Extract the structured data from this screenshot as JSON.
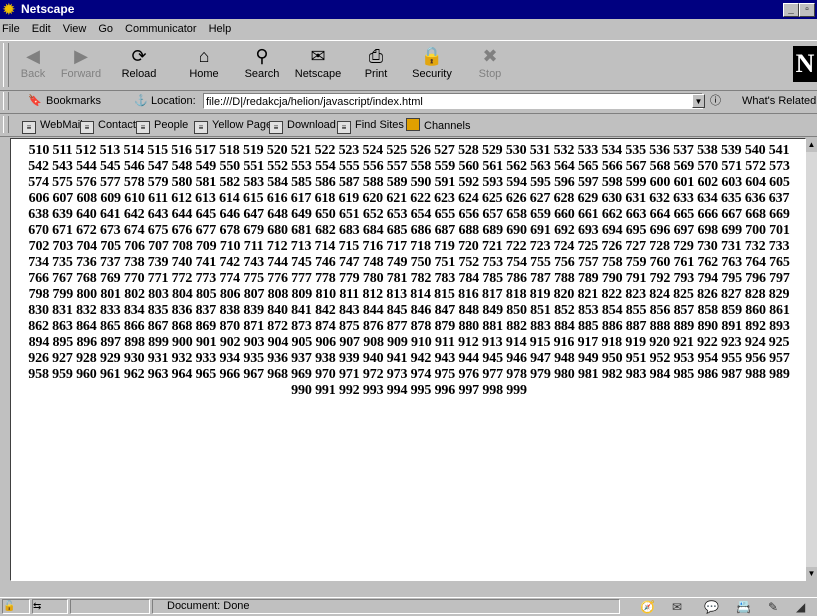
{
  "window": {
    "title": "Netscape"
  },
  "menu": [
    "File",
    "Edit",
    "View",
    "Go",
    "Communicator",
    "Help"
  ],
  "toolbar": {
    "buttons": [
      {
        "label": "Back",
        "icon": "back-arrow-icon",
        "glyph": "◀",
        "disabled": true
      },
      {
        "label": "Forward",
        "icon": "forward-arrow-icon",
        "glyph": "▶",
        "disabled": true
      },
      {
        "label": "Reload",
        "icon": "reload-icon",
        "glyph": "⟳",
        "disabled": false
      },
      {
        "label": "Home",
        "icon": "home-icon",
        "glyph": "⌂",
        "disabled": false
      },
      {
        "label": "Search",
        "icon": "search-icon",
        "glyph": "⚲",
        "disabled": false
      },
      {
        "label": "Netscape",
        "icon": "netscape-icon",
        "glyph": "✉",
        "disabled": false
      },
      {
        "label": "Print",
        "icon": "print-icon",
        "glyph": "⎙",
        "disabled": false
      },
      {
        "label": "Security",
        "icon": "security-lock-icon",
        "glyph": "🔒",
        "disabled": false
      },
      {
        "label": "Stop",
        "icon": "stop-icon",
        "glyph": "✖",
        "disabled": true
      }
    ],
    "logo": "N"
  },
  "location": {
    "bookmarks_label": "Bookmarks",
    "location_label": "Location:",
    "url": "file:///D|/redakcja/helion/javascript/index.html",
    "whats_related": "What's Related"
  },
  "personal_toolbar": [
    "WebMail",
    "Contact",
    "People",
    "Yellow Pages",
    "Download",
    "Find Sites",
    "Channels"
  ],
  "content": {
    "range_start": 510,
    "range_end": 999
  },
  "status": {
    "text": "Document: Done"
  },
  "colors": {
    "titlebar": "#000080",
    "chrome": "#c0c0c0",
    "page_bg": "#ffffff"
  }
}
